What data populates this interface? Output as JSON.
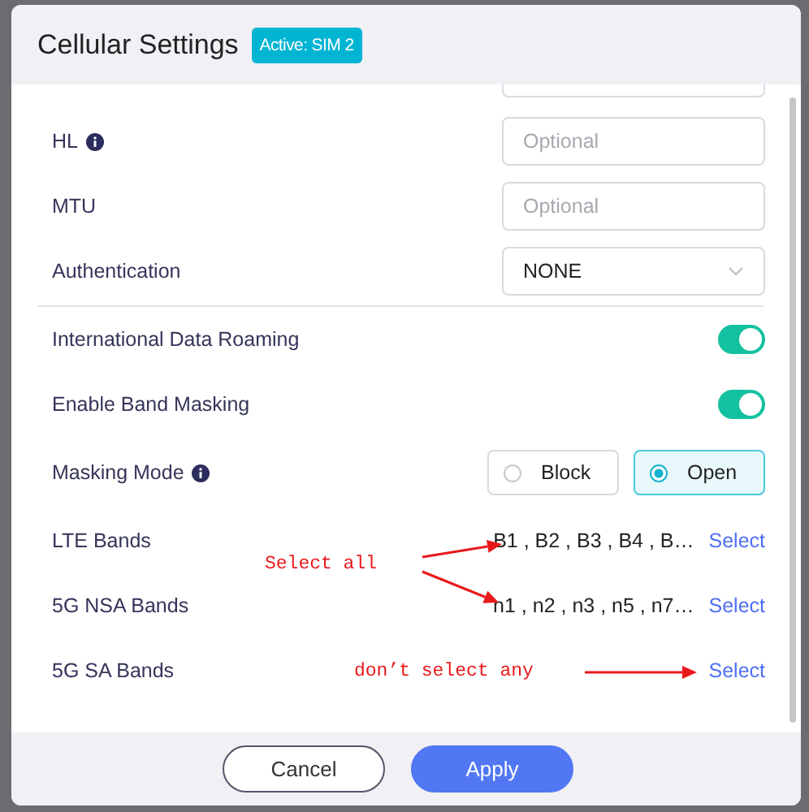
{
  "dialog": {
    "title": "Cellular Settings",
    "badge": "Active: SIM 2"
  },
  "sections": [
    [
      {
        "kind": "input",
        "label": "HL",
        "info": true,
        "placeholder": "Optional"
      },
      {
        "kind": "input",
        "label": "MTU",
        "info": false,
        "placeholder": "Optional"
      },
      {
        "kind": "select",
        "label": "Authentication",
        "info": false,
        "value": "NONE"
      }
    ],
    [
      {
        "kind": "toggle",
        "label": "International Data Roaming",
        "info": false,
        "on": true
      },
      {
        "kind": "toggle",
        "label": "Enable Band Masking",
        "info": false,
        "on": true
      },
      {
        "kind": "radio",
        "label": "Masking Mode",
        "info": true,
        "options": [
          {
            "label": "Block",
            "selected": false
          },
          {
            "label": "Open",
            "selected": true
          }
        ]
      },
      {
        "kind": "bands",
        "label": "LTE Bands",
        "info": false,
        "value": "B1 , B2 , B3 , B4 , B…",
        "action": "Select"
      },
      {
        "kind": "bands",
        "label": "5G NSA Bands",
        "info": false,
        "value": "n1 , n2 , n3 , n5 , n7…",
        "action": "Select"
      },
      {
        "kind": "bands",
        "label": "5G SA Bands",
        "info": false,
        "action": "Select"
      }
    ]
  ],
  "buttons": [
    {
      "label": "Cancel",
      "kind": "secondary"
    },
    {
      "label": "Apply",
      "kind": "primary"
    }
  ],
  "annotations": [
    {
      "text": "Select all",
      "kind": "note"
    },
    {
      "text": "don’t select any",
      "kind": "note"
    }
  ]
}
